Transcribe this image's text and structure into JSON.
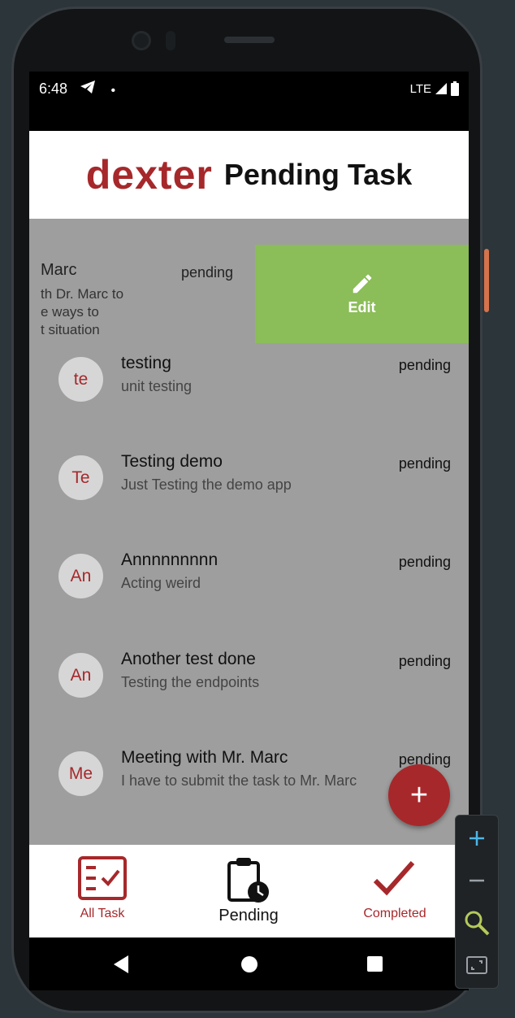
{
  "status_bar": {
    "time": "6:48",
    "network": "LTE"
  },
  "header": {
    "brand": "dexter",
    "title": "Pending Task"
  },
  "swiped_item": {
    "title": "Marc",
    "subtitle": "th Dr. Marc to\ne ways to\nt situation",
    "status": "pending",
    "action_label": "Edit",
    "action_color": "#8bbd58"
  },
  "tasks": [
    {
      "avatar": "te",
      "title": "testing",
      "subtitle": "unit testing",
      "status": "pending"
    },
    {
      "avatar": "Te",
      "title": "Testing demo",
      "subtitle": "Just Testing the demo app",
      "status": "pending"
    },
    {
      "avatar": "An",
      "title": "Annnnnnnnn",
      "subtitle": "Acting weird",
      "status": "pending"
    },
    {
      "avatar": "An",
      "title": "Another test done",
      "subtitle": "Testing the endpoints",
      "status": "pending"
    },
    {
      "avatar": "Me",
      "title": "Meeting with Mr. Marc",
      "subtitle": "I have to submit the task to Mr. Marc",
      "status": "pending"
    }
  ],
  "fab": {
    "icon": "plus-icon",
    "label": "+"
  },
  "bottom_nav": {
    "all_task": "All Task",
    "pending": "Pending",
    "completed": "Completed"
  },
  "colors": {
    "accent": "#a6282b",
    "overlay": "#9e9e9e",
    "edit": "#8bbd58"
  }
}
